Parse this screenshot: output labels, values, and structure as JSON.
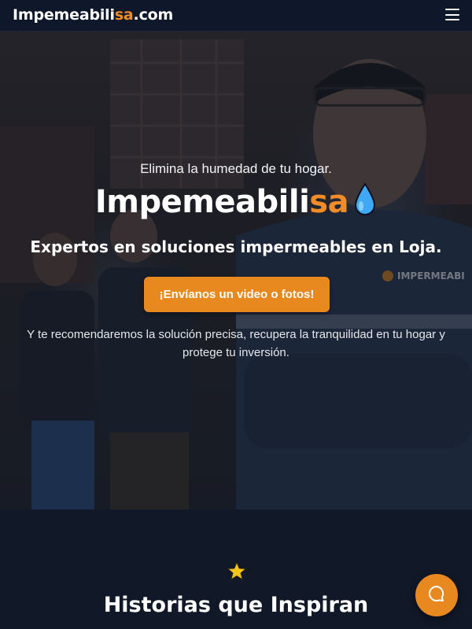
{
  "navbar": {
    "brand_main": "Impemeabili",
    "brand_highlight": "sa",
    "brand_suffix": ".com",
    "menu_icon": "hamburger-menu-icon"
  },
  "hero": {
    "tagline": "Elimina la humedad de tu hogar.",
    "title_main": "Impemeabili",
    "title_highlight": "sa",
    "title_icon": "water-drop-icon",
    "subtitle": "Expertos en soluciones impermeables en Loja.",
    "cta_label": "¡Envíanos un video o fotos!",
    "description": "Y te recomendaremos la solución precisa, recupera la tranquilidad en tu hogar y protege tu inversión.",
    "background_text": "IMPERMEABI"
  },
  "stories": {
    "icon": "star-icon",
    "title": "Historias que Inspiran"
  },
  "chat": {
    "icon": "chat-bubble-icon"
  },
  "colors": {
    "accent": "#e8891f",
    "brand_highlight": "#f28c28",
    "background": "#111827",
    "drop": "#3fa9f5"
  }
}
